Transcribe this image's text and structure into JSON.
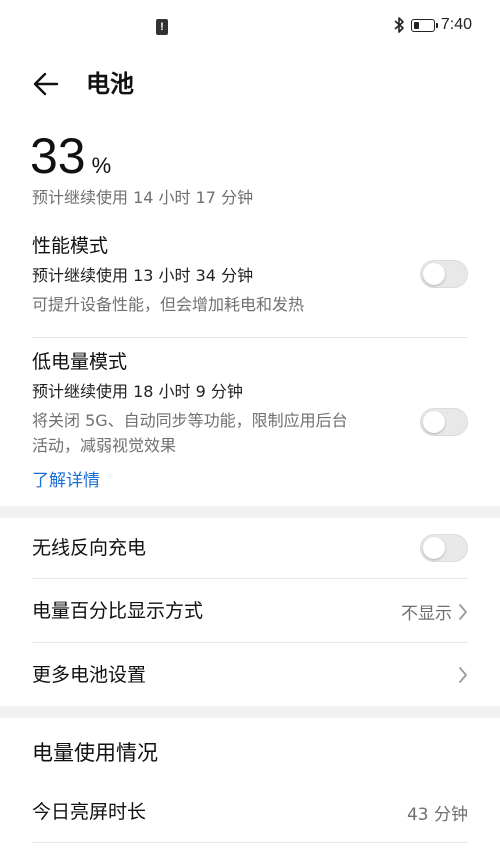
{
  "status_bar": {
    "notification_icon": "alert-icon",
    "notification_glyph": "!",
    "bluetooth_icon": "bluetooth-icon",
    "battery_icon": "battery-icon",
    "battery_level": 0.33,
    "time": "7:40"
  },
  "app_bar": {
    "back_icon": "arrow-left-icon",
    "title": "电池"
  },
  "battery": {
    "percent": "33",
    "percent_sign": "%",
    "estimate": "预计继续使用 14 小时 17 分钟"
  },
  "performance_mode": {
    "title": "性能模式",
    "estimate": "预计继续使用 13 小时 34 分钟",
    "description": "可提升设备性能，但会增加耗电和发热",
    "enabled": false
  },
  "low_power_mode": {
    "title": "低电量模式",
    "estimate": "预计继续使用 18 小时 9 分钟",
    "description_line1": "将关闭 5G、自动同步等功能，限制应用后台",
    "description_line2": "活动，减弱视觉效果",
    "learn_more": "了解详情",
    "enabled": false
  },
  "settings": {
    "wireless_reverse_charging": {
      "label": "无线反向充电",
      "enabled": false
    },
    "percentage_display": {
      "label": "电量百分比显示方式",
      "value": "不显示"
    },
    "more_battery_settings": {
      "label": "更多电池设置"
    }
  },
  "usage": {
    "header": "电量使用情况",
    "screen_on_today": {
      "label": "今日亮屏时长",
      "value": "43 分钟"
    }
  },
  "colors": {
    "accent_link": "#1a6fd6",
    "toggle_off": "#e8e8e8",
    "secondary_text": "#707070"
  }
}
